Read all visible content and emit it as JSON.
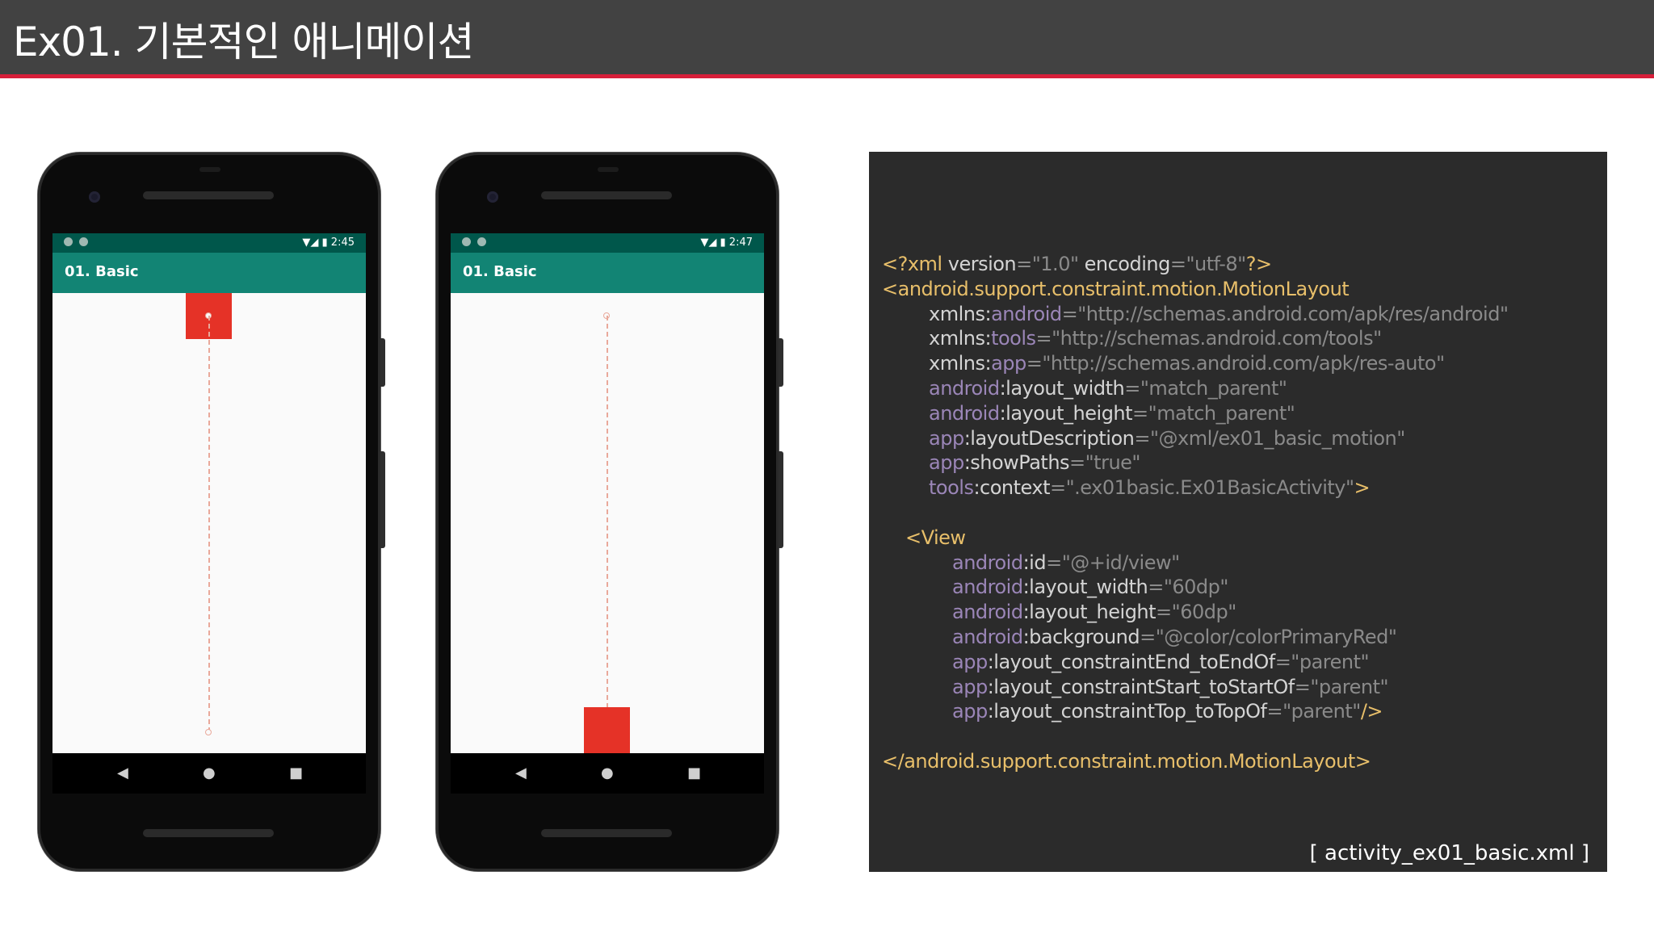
{
  "slide": {
    "title": "Ex01. 기본적인 애니메이션",
    "accent_color": "#d71f3a",
    "header_bg": "#424242"
  },
  "phones": [
    {
      "status_time": "2:45",
      "app_title": "01. Basic",
      "box_position": "start",
      "nav": {
        "back": "◀",
        "home": "●",
        "recents": "■"
      }
    },
    {
      "status_time": "2:47",
      "app_title": "01. Basic",
      "box_position": "end",
      "nav": {
        "back": "◀",
        "home": "●",
        "recents": "■"
      }
    }
  ],
  "code": {
    "lines": [
      [
        [
          "tag",
          "<?xml "
        ],
        [
          "attr",
          "version"
        ],
        [
          "str",
          "=\"1.0\" "
        ],
        [
          "attr",
          "encoding"
        ],
        [
          "str",
          "=\"utf-8\""
        ],
        [
          "tag",
          "?>"
        ]
      ],
      [
        [
          "tag",
          "<android.support.constraint.motion.MotionLayout"
        ]
      ],
      [
        [
          "attr",
          "xmlns:"
        ],
        [
          "ns",
          "android"
        ],
        [
          "str",
          "=\"http://schemas.android.com/apk/res/android\""
        ]
      ],
      [
        [
          "attr",
          "xmlns:"
        ],
        [
          "ns",
          "tools"
        ],
        [
          "str",
          "=\"http://schemas.android.com/tools\""
        ]
      ],
      [
        [
          "attr",
          "xmlns:"
        ],
        [
          "ns",
          "app"
        ],
        [
          "str",
          "=\"http://schemas.android.com/apk/res-auto\""
        ]
      ],
      [
        [
          "ns",
          "android"
        ],
        [
          "attr",
          ":layout_width"
        ],
        [
          "str",
          "=\"match_parent\""
        ]
      ],
      [
        [
          "ns",
          "android"
        ],
        [
          "attr",
          ":layout_height"
        ],
        [
          "str",
          "=\"match_parent\""
        ]
      ],
      [
        [
          "ns",
          "app"
        ],
        [
          "attr",
          ":layoutDescription"
        ],
        [
          "str",
          "=\"@xml/ex01_basic_motion\""
        ]
      ],
      [
        [
          "ns",
          "app"
        ],
        [
          "attr",
          ":showPaths"
        ],
        [
          "str",
          "=\"true\""
        ]
      ],
      [
        [
          "ns",
          "tools"
        ],
        [
          "attr",
          ":context"
        ],
        [
          "str",
          "=\".ex01basic.Ex01BasicActivity\""
        ],
        [
          "tag",
          ">"
        ]
      ],
      [],
      [
        [
          "tag",
          "<View"
        ]
      ],
      [
        [
          "ns",
          "android"
        ],
        [
          "attr",
          ":id"
        ],
        [
          "str",
          "=\"@+id/view\""
        ]
      ],
      [
        [
          "ns",
          "android"
        ],
        [
          "attr",
          ":layout_width"
        ],
        [
          "str",
          "=\"60dp\""
        ]
      ],
      [
        [
          "ns",
          "android"
        ],
        [
          "attr",
          ":layout_height"
        ],
        [
          "str",
          "=\"60dp\""
        ]
      ],
      [
        [
          "ns",
          "android"
        ],
        [
          "attr",
          ":background"
        ],
        [
          "str",
          "=\"@color/colorPrimaryRed\""
        ]
      ],
      [
        [
          "ns",
          "app"
        ],
        [
          "attr",
          ":layout_constraintEnd_toEndOf"
        ],
        [
          "str",
          "=\"parent\""
        ]
      ],
      [
        [
          "ns",
          "app"
        ],
        [
          "attr",
          ":layout_constraintStart_toStartOf"
        ],
        [
          "str",
          "=\"parent\""
        ]
      ],
      [
        [
          "ns",
          "app"
        ],
        [
          "attr",
          ":layout_constraintTop_toTopOf"
        ],
        [
          "str",
          "=\"parent\""
        ],
        [
          "tag",
          "/>"
        ]
      ],
      [],
      [
        [
          "tag",
          "</android.support.constraint.motion.MotionLayout>"
        ]
      ]
    ],
    "file_label": "[ activity_ex01_basic.xml ]"
  }
}
